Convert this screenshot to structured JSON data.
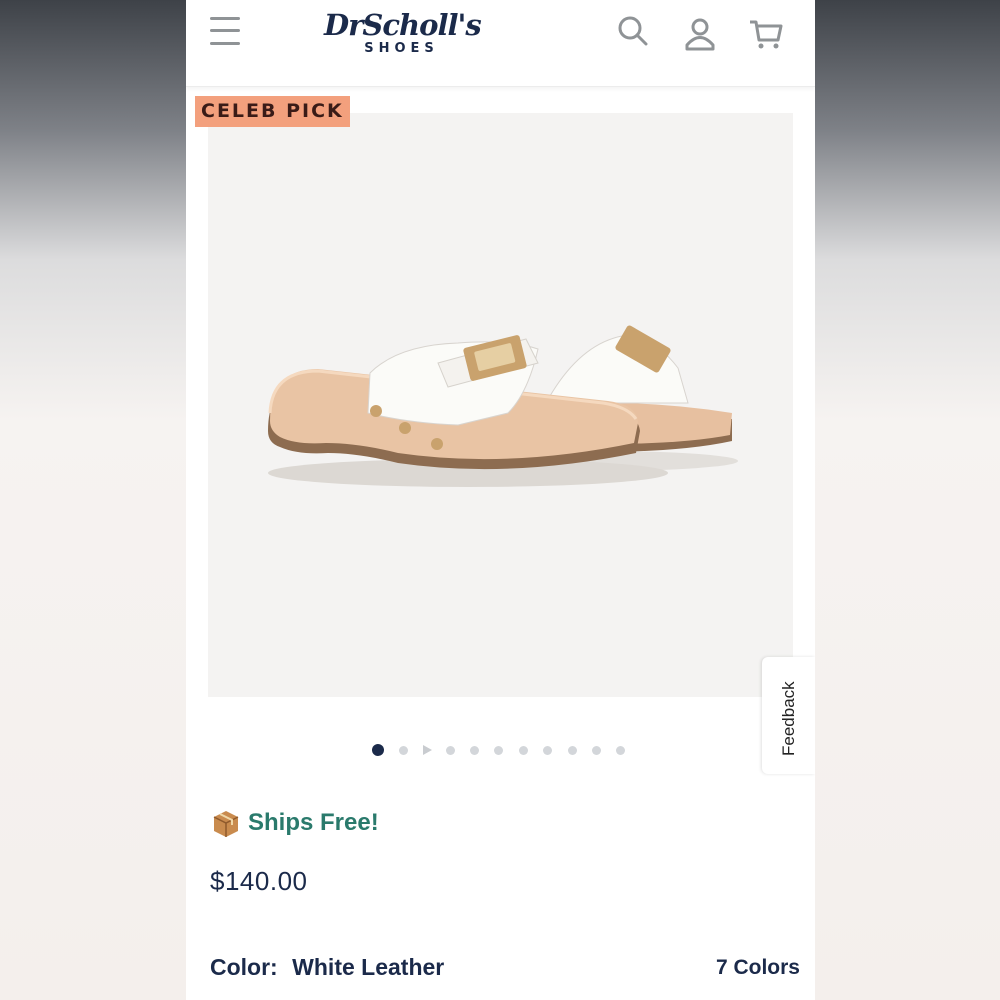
{
  "header": {
    "brand_name": "DrScholl's",
    "brand_sub": "SHOES",
    "icons": [
      "menu-icon",
      "search-icon",
      "account-icon",
      "cart-icon"
    ]
  },
  "product": {
    "badge": "CELEB PICK",
    "image_description": "",
    "gallery_current": 1,
    "gallery_count": 11,
    "shipping": "Ships Free!",
    "price": "$140.00",
    "color_label": "Color:",
    "color_value": "White Leather",
    "colors_count": "7 Colors"
  },
  "feedback_tab": "Feedback",
  "colors": {
    "navy": "#1b2a4a",
    "badge_bg": "#f3a07d",
    "ships_green": "#2a7a6c"
  }
}
